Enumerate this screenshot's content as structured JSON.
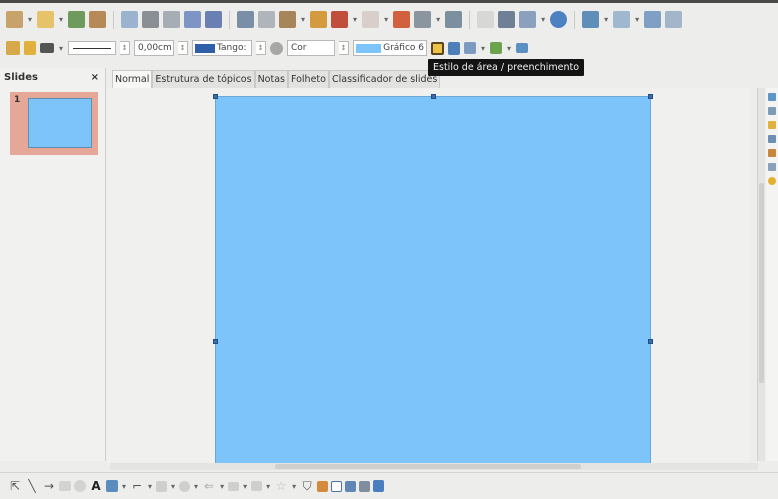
{
  "toolbar_line": {
    "width_value": "0,00cm",
    "color_name": "Tango:",
    "area_mode": "Cor",
    "area_fill": "Gráfico 6"
  },
  "tooltip": "Estilo de área / preenchimento",
  "slides_panel": {
    "title": "Slides",
    "close_glyph": "×",
    "slide_number": "1"
  },
  "tabs": [
    "Normal",
    "Estrutura de tópicos",
    "Notas",
    "Folheto",
    "Classificador de slides"
  ],
  "colors": {
    "slide_fill": "#7dc4fa",
    "selection_handle": "#3c6ea8",
    "thumb_highlight": "#e5a898",
    "line_color_swatch": "#2f5fa8",
    "area_fill_swatch": "#7dc4fa"
  },
  "toolbar_icons": [
    "new-icon",
    "open-icon",
    "save-icon",
    "export-icon",
    "pdf-icon",
    "print-icon",
    "spellcheck-icon",
    "autocorrect-icon",
    "cut-icon",
    "copy-icon",
    "paste-icon",
    "clone-formatting-icon",
    "undo-icon",
    "redo-icon",
    "chart-icon",
    "table-icon",
    "image-icon",
    "grid-icon",
    "navigator-icon",
    "zoom-icon",
    "help-icon",
    "display-views-icon",
    "slide-layout-icon",
    "start-presentation-icon"
  ],
  "drawing_icons": [
    "select-icon",
    "line-icon",
    "arrow-line-icon",
    "rectangle-icon",
    "ellipse-icon",
    "fontwork-icon",
    "curve-icon",
    "connector-icon",
    "basic-shapes-icon",
    "symbol-shapes-icon",
    "block-arrows-icon",
    "flowchart-icon",
    "callouts-icon",
    "stars-icon",
    "points-icon",
    "glue-points-icon",
    "text-icon",
    "image-icon",
    "table-icon",
    "3d-objects-icon"
  ]
}
